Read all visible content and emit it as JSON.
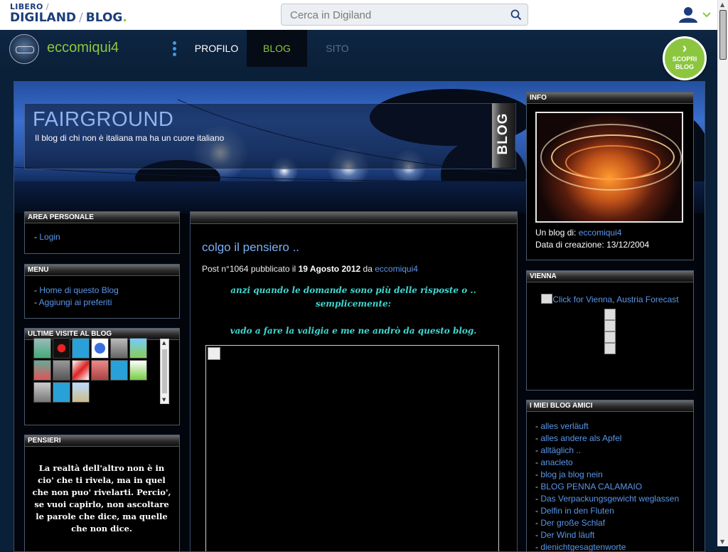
{
  "topbar": {
    "logo_libero": "LIBERO",
    "logo_digiland": "DIGILAND",
    "logo_blog": "BLOG",
    "search_placeholder": "Cerca in Digiland"
  },
  "header": {
    "username": "eccomiqui4",
    "nav_profilo": "PROFILO",
    "nav_blog": "BLOG",
    "nav_sito": "SITO",
    "scopri_line1": "SCOPRI",
    "scopri_line2": "BLOG"
  },
  "blog": {
    "title": "FAIRGROUND",
    "subtitle": "Il blog di chi non è italiana ma ha un cuore italiano",
    "vertical_label": "BLOG"
  },
  "left": {
    "area_personale": {
      "title": "AREA PERSONALE",
      "login": "Login"
    },
    "menu": {
      "title": "MENU",
      "items": [
        "Home di questo Blog",
        "Aggiungi ai preferiti"
      ]
    },
    "ultime_visite": {
      "title": "ULTIME VISITE AL BLOG"
    },
    "pensieri": {
      "title": "PENSIERI",
      "text": "La realtà dell'altro non è in cio' che ti rivela, ma in quel che non puo' rivelarti. Percio', se vuoi capirlo, non ascoltare le parole che dice, ma quelle che non dice."
    }
  },
  "post": {
    "title": "colgo il pensiero ..",
    "meta_prefix": "Post n°1064 pubblicato il",
    "meta_date": "19 Agosto 2012",
    "meta_by": "da",
    "meta_author": "eccomiqui4",
    "line1": "anzi quando le domande sono più delle risposte o ..",
    "line2": "semplicemente:",
    "line3": "vado a fare la valigia e me ne andrò da questo blog."
  },
  "right": {
    "info": {
      "title": "INFO",
      "blog_di_label": "Un blog di:",
      "blog_di_value": "eccomiqui4",
      "data_label": "Data di creazione:",
      "data_value": "13/12/2004"
    },
    "vienna": {
      "title": "VIENNA",
      "forecast_link": "Click for Vienna, Austria Forecast"
    },
    "amici": {
      "title": "I MIEI BLOG AMICI",
      "items": [
        "alles verläuft",
        "alles andere als Apfel",
        "alltäglich ..",
        "anacleto",
        "blog ja blog nein",
        "BLOG PENNA CALAMAIO",
        "Das Verpackungsgewicht weglassen",
        "Delfin in den Fluten",
        "Der große Schlaf",
        "Der Wind läuft",
        "dienichtgesagtenworte"
      ]
    }
  },
  "colors": {
    "accent_green": "#8cc63f",
    "link_blue": "#5a96ea",
    "post_text_cyan": "#3fd7d2"
  }
}
